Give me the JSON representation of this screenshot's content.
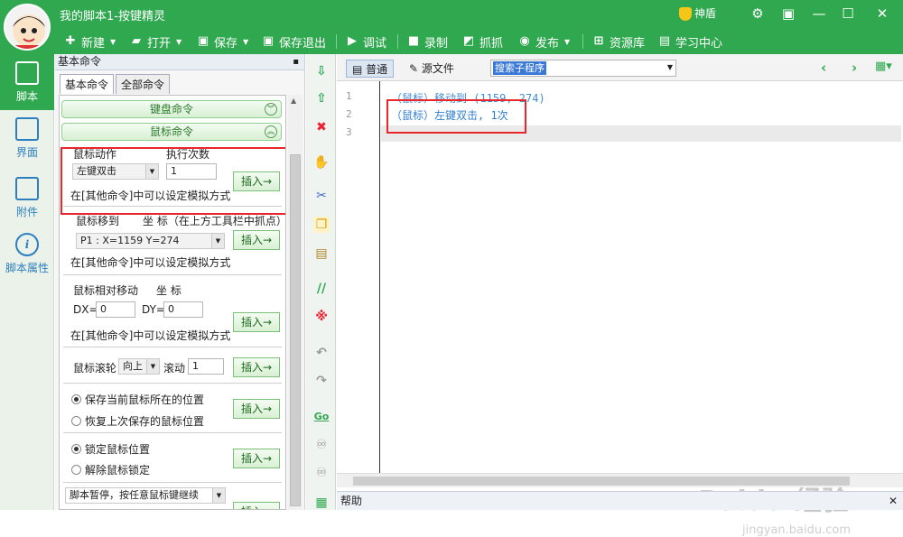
{
  "title": "我的脚本1-按键精灵",
  "shield_label": "神盾",
  "menu": {
    "new": "新建",
    "open": "打开",
    "save": "保存",
    "save_exit": "保存退出",
    "debug": "调试",
    "record": "录制",
    "capture": "抓抓",
    "publish": "发布",
    "resources": "资源库",
    "learn": "学习中心"
  },
  "leftnav": {
    "script": "脚本",
    "ui": "界面",
    "attach": "附件",
    "props": "脚本属性"
  },
  "panel": {
    "title": "基本命令",
    "tab_basic": "基本命令",
    "tab_all": "全部命令",
    "keyboard_group": "键盘命令",
    "mouse_group": "鼠标命令",
    "mouse_action_label": "鼠标动作",
    "exec_count_label": "执行次数",
    "mouse_action_value": "左键双击",
    "exec_count_value": "1",
    "insert": "插入→",
    "sim_note": "在[其他命令]中可以设定模拟方式",
    "move_label": "鼠标移到",
    "coord_label": "坐 标（在上方工具栏中抓点）",
    "point_value": "P1 : X=1159 Y=274",
    "rel_move_label": "鼠标相对移动",
    "coord2_label": "坐 标",
    "dx_label": "DX=",
    "dx_value": "0",
    "dy_label": "DY=",
    "dy_value": "0",
    "wheel_label": "鼠标滚轮",
    "wheel_dir": "向上",
    "wheel_scroll_label": "滚动",
    "wheel_value": "1",
    "save_pos": "保存当前鼠标所在的位置",
    "restore_pos": "恢复上次保存的鼠标位置",
    "lock_mouse": "锁定鼠标位置",
    "unlock_mouse": "解除鼠标锁定",
    "pause_label": "脚本暂停，按任意鼠标键继续"
  },
  "editor": {
    "mode_normal": "普通",
    "mode_source": "源文件",
    "search_value": "搜索子程序",
    "lines": [
      "1",
      "2",
      "3"
    ],
    "code": [
      "（鼠标）移动到 (1159, 274)",
      "（鼠标）左键双击, 1次"
    ]
  },
  "help_label": "帮助",
  "watermark": "Baidu 经验",
  "watermark_url": "jingyan.baidu.com",
  "colors": {
    "accent": "#2fa84f",
    "highlight_red": "#e8262b",
    "code_blue": "#2f7fd0"
  }
}
